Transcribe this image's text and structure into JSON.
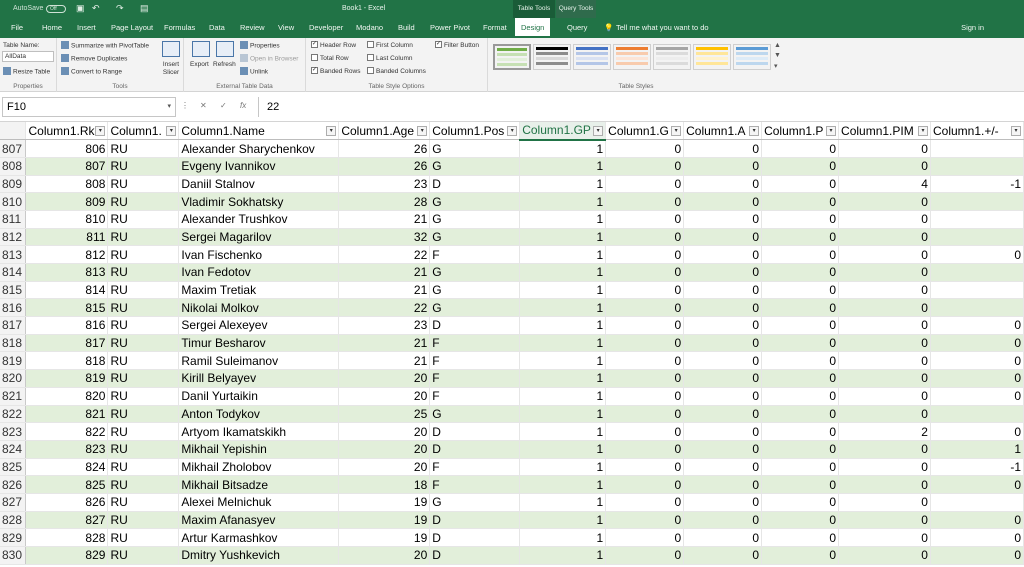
{
  "titlebar": {
    "autosave": "AutoSave",
    "toggle": "Off",
    "title": "Book1 - Excel",
    "ctx_table": "Table Tools",
    "ctx_query": "Query Tools"
  },
  "tabs": [
    "File",
    "Home",
    "Insert",
    "Page Layout",
    "Formulas",
    "Data",
    "Review",
    "View",
    "Developer",
    "Modano",
    "Build",
    "Power Pivot",
    "Format",
    "Design",
    "Query"
  ],
  "tell_me": "Tell me what you want to do",
  "sign_in": "Sign in",
  "ribbon": {
    "properties": {
      "table_name_label": "Table Name:",
      "table_name": "AllData",
      "resize": "Resize Table",
      "label": "Properties"
    },
    "tools": {
      "summarize": "Summarize with PivotTable",
      "remove_dup": "Remove Duplicates",
      "convert": "Convert to Range",
      "insert_slicer": "Insert Slicer",
      "label": "Tools"
    },
    "external": {
      "export": "Export",
      "refresh": "Refresh",
      "properties": "Properties",
      "open_browser": "Open in Browser",
      "unlink": "Unlink",
      "label": "External Table Data"
    },
    "style_options": {
      "header_row": "Header Row",
      "total_row": "Total Row",
      "banded_rows": "Banded Rows",
      "first_column": "First Column",
      "last_column": "Last Column",
      "banded_columns": "Banded Columns",
      "filter_button": "Filter Button",
      "label": "Table Style Options"
    },
    "styles": {
      "label": "Table Styles"
    }
  },
  "formula": {
    "namebox": "F10",
    "value": "22"
  },
  "columns": [
    "Column1.Rk",
    "Column1.",
    "Column1.Name",
    "Column1.Age",
    "Column1.Pos",
    "Column1.GP",
    "Column1.G",
    "Column1.A",
    "Column1.P",
    "Column1.PIM",
    "Column1.+/-"
  ],
  "rows": [
    [
      "807",
      "806",
      "RU",
      "Alexander Sharychenkov",
      "26",
      "G",
      "1",
      "0",
      "0",
      "0",
      "0",
      ""
    ],
    [
      "808",
      "807",
      "RU",
      "Evgeny Ivannikov",
      "26",
      "G",
      "1",
      "0",
      "0",
      "0",
      "0",
      ""
    ],
    [
      "809",
      "808",
      "RU",
      "Daniil Stalnov",
      "23",
      "D",
      "1",
      "0",
      "0",
      "0",
      "4",
      "-1"
    ],
    [
      "810",
      "809",
      "RU",
      "Vladimir Sokhatsky",
      "28",
      "G",
      "1",
      "0",
      "0",
      "0",
      "0",
      ""
    ],
    [
      "811",
      "810",
      "RU",
      "Alexander Trushkov",
      "21",
      "G",
      "1",
      "0",
      "0",
      "0",
      "0",
      ""
    ],
    [
      "812",
      "811",
      "RU",
      "Sergei Magarilov",
      "32",
      "G",
      "1",
      "0",
      "0",
      "0",
      "0",
      ""
    ],
    [
      "813",
      "812",
      "RU",
      "Ivan Fischenko",
      "22",
      "F",
      "1",
      "0",
      "0",
      "0",
      "0",
      "0"
    ],
    [
      "814",
      "813",
      "RU",
      "Ivan Fedotov",
      "21",
      "G",
      "1",
      "0",
      "0",
      "0",
      "0",
      ""
    ],
    [
      "815",
      "814",
      "RU",
      "Maxim Tretiak",
      "21",
      "G",
      "1",
      "0",
      "0",
      "0",
      "0",
      ""
    ],
    [
      "816",
      "815",
      "RU",
      "Nikolai Molkov",
      "22",
      "G",
      "1",
      "0",
      "0",
      "0",
      "0",
      ""
    ],
    [
      "817",
      "816",
      "RU",
      "Sergei Alexeyev",
      "23",
      "D",
      "1",
      "0",
      "0",
      "0",
      "0",
      "0"
    ],
    [
      "818",
      "817",
      "RU",
      "Timur Besharov",
      "21",
      "F",
      "1",
      "0",
      "0",
      "0",
      "0",
      "0"
    ],
    [
      "819",
      "818",
      "RU",
      "Ramil Suleimanov",
      "21",
      "F",
      "1",
      "0",
      "0",
      "0",
      "0",
      "0"
    ],
    [
      "820",
      "819",
      "RU",
      "Kirill Belyayev",
      "20",
      "F",
      "1",
      "0",
      "0",
      "0",
      "0",
      "0"
    ],
    [
      "821",
      "820",
      "RU",
      "Danil Yurtaikin",
      "20",
      "F",
      "1",
      "0",
      "0",
      "0",
      "0",
      "0"
    ],
    [
      "822",
      "821",
      "RU",
      "Anton Todykov",
      "25",
      "G",
      "1",
      "0",
      "0",
      "0",
      "0",
      ""
    ],
    [
      "823",
      "822",
      "RU",
      "Artyom Ikamatskikh",
      "20",
      "D",
      "1",
      "0",
      "0",
      "0",
      "2",
      "0"
    ],
    [
      "824",
      "823",
      "RU",
      "Mikhail Yepishin",
      "20",
      "D",
      "1",
      "0",
      "0",
      "0",
      "0",
      "1"
    ],
    [
      "825",
      "824",
      "RU",
      "Mikhail Zholobov",
      "20",
      "F",
      "1",
      "0",
      "0",
      "0",
      "0",
      "-1"
    ],
    [
      "826",
      "825",
      "RU",
      "Mikhail Bitsadze",
      "18",
      "F",
      "1",
      "0",
      "0",
      "0",
      "0",
      "0"
    ],
    [
      "827",
      "826",
      "RU",
      "Alexei Melnichuk",
      "19",
      "G",
      "1",
      "0",
      "0",
      "0",
      "0",
      ""
    ],
    [
      "828",
      "827",
      "RU",
      "Maxim Afanasyev",
      "19",
      "D",
      "1",
      "0",
      "0",
      "0",
      "0",
      "0"
    ],
    [
      "829",
      "828",
      "RU",
      "Artur Karmashkov",
      "19",
      "D",
      "1",
      "0",
      "0",
      "0",
      "0",
      "0"
    ],
    [
      "830",
      "829",
      "RU",
      "Dmitry Yushkevich",
      "20",
      "D",
      "1",
      "0",
      "0",
      "0",
      "0",
      "0"
    ]
  ],
  "colors": {
    "accent": "#217346",
    "band": "#e2efda"
  }
}
